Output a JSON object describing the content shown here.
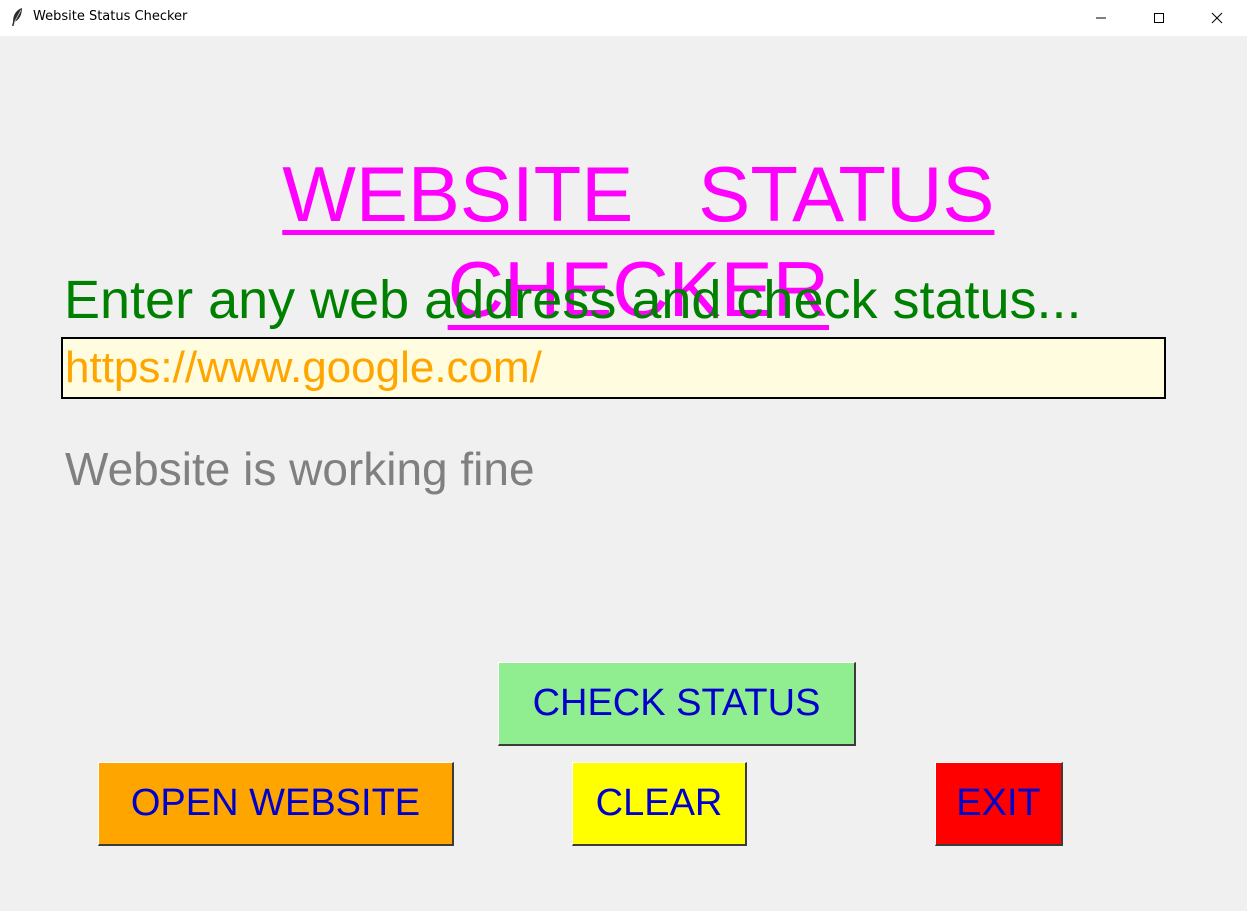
{
  "window": {
    "title": "Website Status Checker",
    "icon": "feather-icon",
    "controls": [
      "minimize-icon",
      "maximize-icon",
      "close-icon"
    ]
  },
  "heading": {
    "line1": "WEBSITE   STATUS",
    "line2": "CHECKER",
    "color": "#ff00ff"
  },
  "prompt": {
    "text": "Enter any web address and check status...",
    "color": "#008000"
  },
  "url_input": {
    "value": "https://www.google.com/",
    "text_color": "#ffa500",
    "background": "#fffce0"
  },
  "status": {
    "text": "Website is working fine",
    "color": "#808080"
  },
  "buttons": {
    "check_status": {
      "label": "CHECK STATUS",
      "background": "#90ee90"
    },
    "open_website": {
      "label": "OPEN WEBSITE",
      "background": "#ffa500"
    },
    "clear": {
      "label": "CLEAR",
      "background": "#ffff00"
    },
    "exit": {
      "label": "EXIT",
      "background": "#ff0000"
    },
    "text_color": "#0000cd"
  }
}
